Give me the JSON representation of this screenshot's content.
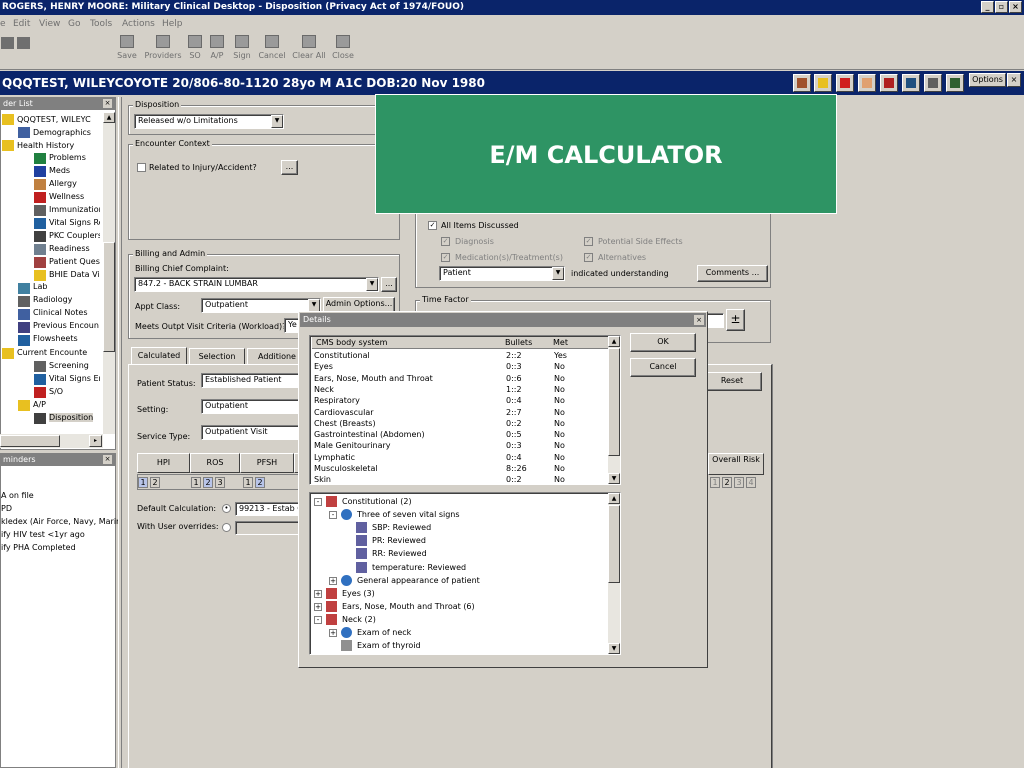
{
  "window": {
    "title": "ROGERS, HENRY MOORE: Military Clinical Desktop - Disposition (Privacy Act of 1974/FOUO)"
  },
  "menu": [
    "e",
    "Edit",
    "View",
    "Go",
    "Tools",
    "Actions",
    "Help"
  ],
  "toolbar": [
    "Save",
    "Providers",
    "SO",
    "A/P",
    "Sign",
    "Cancel",
    "Clear All",
    "Close"
  ],
  "patient": {
    "banner": "QQQTEST, WILEYCOYOTE  20/806-80-1120  28yo  M   A1C  DOB:20 Nov 1980",
    "options_label": "Options"
  },
  "sidebar": {
    "folder_list_title": "der List",
    "tree": [
      "QQQTEST, WILEYC",
      "Demographics",
      "Health History",
      "Problems",
      "Meds",
      "Allergy",
      "Wellness",
      "Immunization",
      "Vital Signs Re",
      "PKC Couplers",
      "Readiness",
      "Patient Quest",
      "BHIE Data Vi",
      "Lab",
      "Radiology",
      "Clinical Notes",
      "Previous Encoun",
      "Flowsheets",
      "Current Encounte",
      "Screening",
      "Vital Signs En",
      "S/O",
      "A/P",
      "Disposition"
    ],
    "reminders_title": "minders",
    "reminders": [
      "A on file",
      "PD",
      "kledex (Air Force, Navy, Marin",
      "ify HIV test <1yr ago",
      "ify PHA Completed"
    ]
  },
  "disposition": {
    "group_title": "Disposition",
    "value": "Released w/o Limitations",
    "encounter_context_title": "Encounter Context",
    "injury_label": "Related to Injury/Accident?",
    "injury_btn": "...",
    "billing_title": "Billing and Admin",
    "chief_complaint_label": "Billing Chief Complaint:",
    "chief_complaint_value": "847.2 - BACK STRAIN LUMBAR",
    "chief_btn": "...",
    "appt_class_label": "Appt Class:",
    "appt_class_value": "Outpatient",
    "admin_options": "Admin Options...",
    "meets_label": "Meets Outpt Visit Criteria (Workload)?",
    "meets_value": "Ye"
  },
  "education": {
    "all_items": "All Items Discussed",
    "diagnosis": "Diagnosis",
    "potential": "Potential Side Effects",
    "medications": "Medication(s)/Treatment(s)",
    "alternatives": "Alternatives",
    "who_value": "Patient",
    "indicated": "indicated understanding",
    "comments": "Comments ..."
  },
  "time_factor": {
    "title": "Time Factor"
  },
  "em_calc": {
    "tabs": [
      "Calculated",
      "Selection",
      "Additione"
    ],
    "patient_status_label": "Patient Status:",
    "patient_status_value": "Established Patient",
    "setting_label": "Setting:",
    "setting_value": "Outpatient",
    "service_type_label": "Service Type:",
    "service_type_value": "Outpatient Visit",
    "grid_headers": [
      "HPI",
      "ROS",
      "PFSH"
    ],
    "grid_nums": [
      "1",
      "2",
      "1",
      "2",
      "3",
      "1",
      "2"
    ],
    "overall_risk": "Overall Risk",
    "risk_nums": [
      "1",
      "2",
      "3",
      "4"
    ],
    "default_calc_label": "Default Calculation:",
    "default_calc_value": "99213 - Estab O",
    "user_overrides_label": "With User overrides:",
    "reset": "Reset"
  },
  "banner": {
    "text": "E/M CALCULATOR"
  },
  "details": {
    "title": "Details",
    "ok": "OK",
    "cancel": "Cancel",
    "columns": [
      "CMS body system",
      "Bullets",
      "Met"
    ],
    "rows": [
      [
        "Constitutional",
        "2::2",
        "Yes"
      ],
      [
        "Eyes",
        "0::3",
        "No"
      ],
      [
        "Ears, Nose, Mouth and Throat",
        "0::6",
        "No"
      ],
      [
        "Neck",
        "1::2",
        "No"
      ],
      [
        "Respiratory",
        "0::4",
        "No"
      ],
      [
        "Cardiovascular",
        "2::7",
        "No"
      ],
      [
        "Chest (Breasts)",
        "0::2",
        "No"
      ],
      [
        "Gastrointestinal (Abdomen)",
        "0::5",
        "No"
      ],
      [
        "Male Genitourinary",
        "0::3",
        "No"
      ],
      [
        "Lymphatic",
        "0::4",
        "No"
      ],
      [
        "Musculoskeletal",
        "8::26",
        "No"
      ],
      [
        "Skin",
        "0::2",
        "No"
      ]
    ],
    "tree": [
      "Constitutional (2)",
      "Three of seven vital signs",
      "SBP: Reviewed",
      "PR: Reviewed",
      "RR: Reviewed",
      "temperature: Reviewed",
      "General appearance of patient",
      "Eyes (3)",
      "Ears, Nose, Mouth and Throat (6)",
      "Neck (2)",
      "Exam of neck",
      "Exam of thyroid"
    ]
  }
}
